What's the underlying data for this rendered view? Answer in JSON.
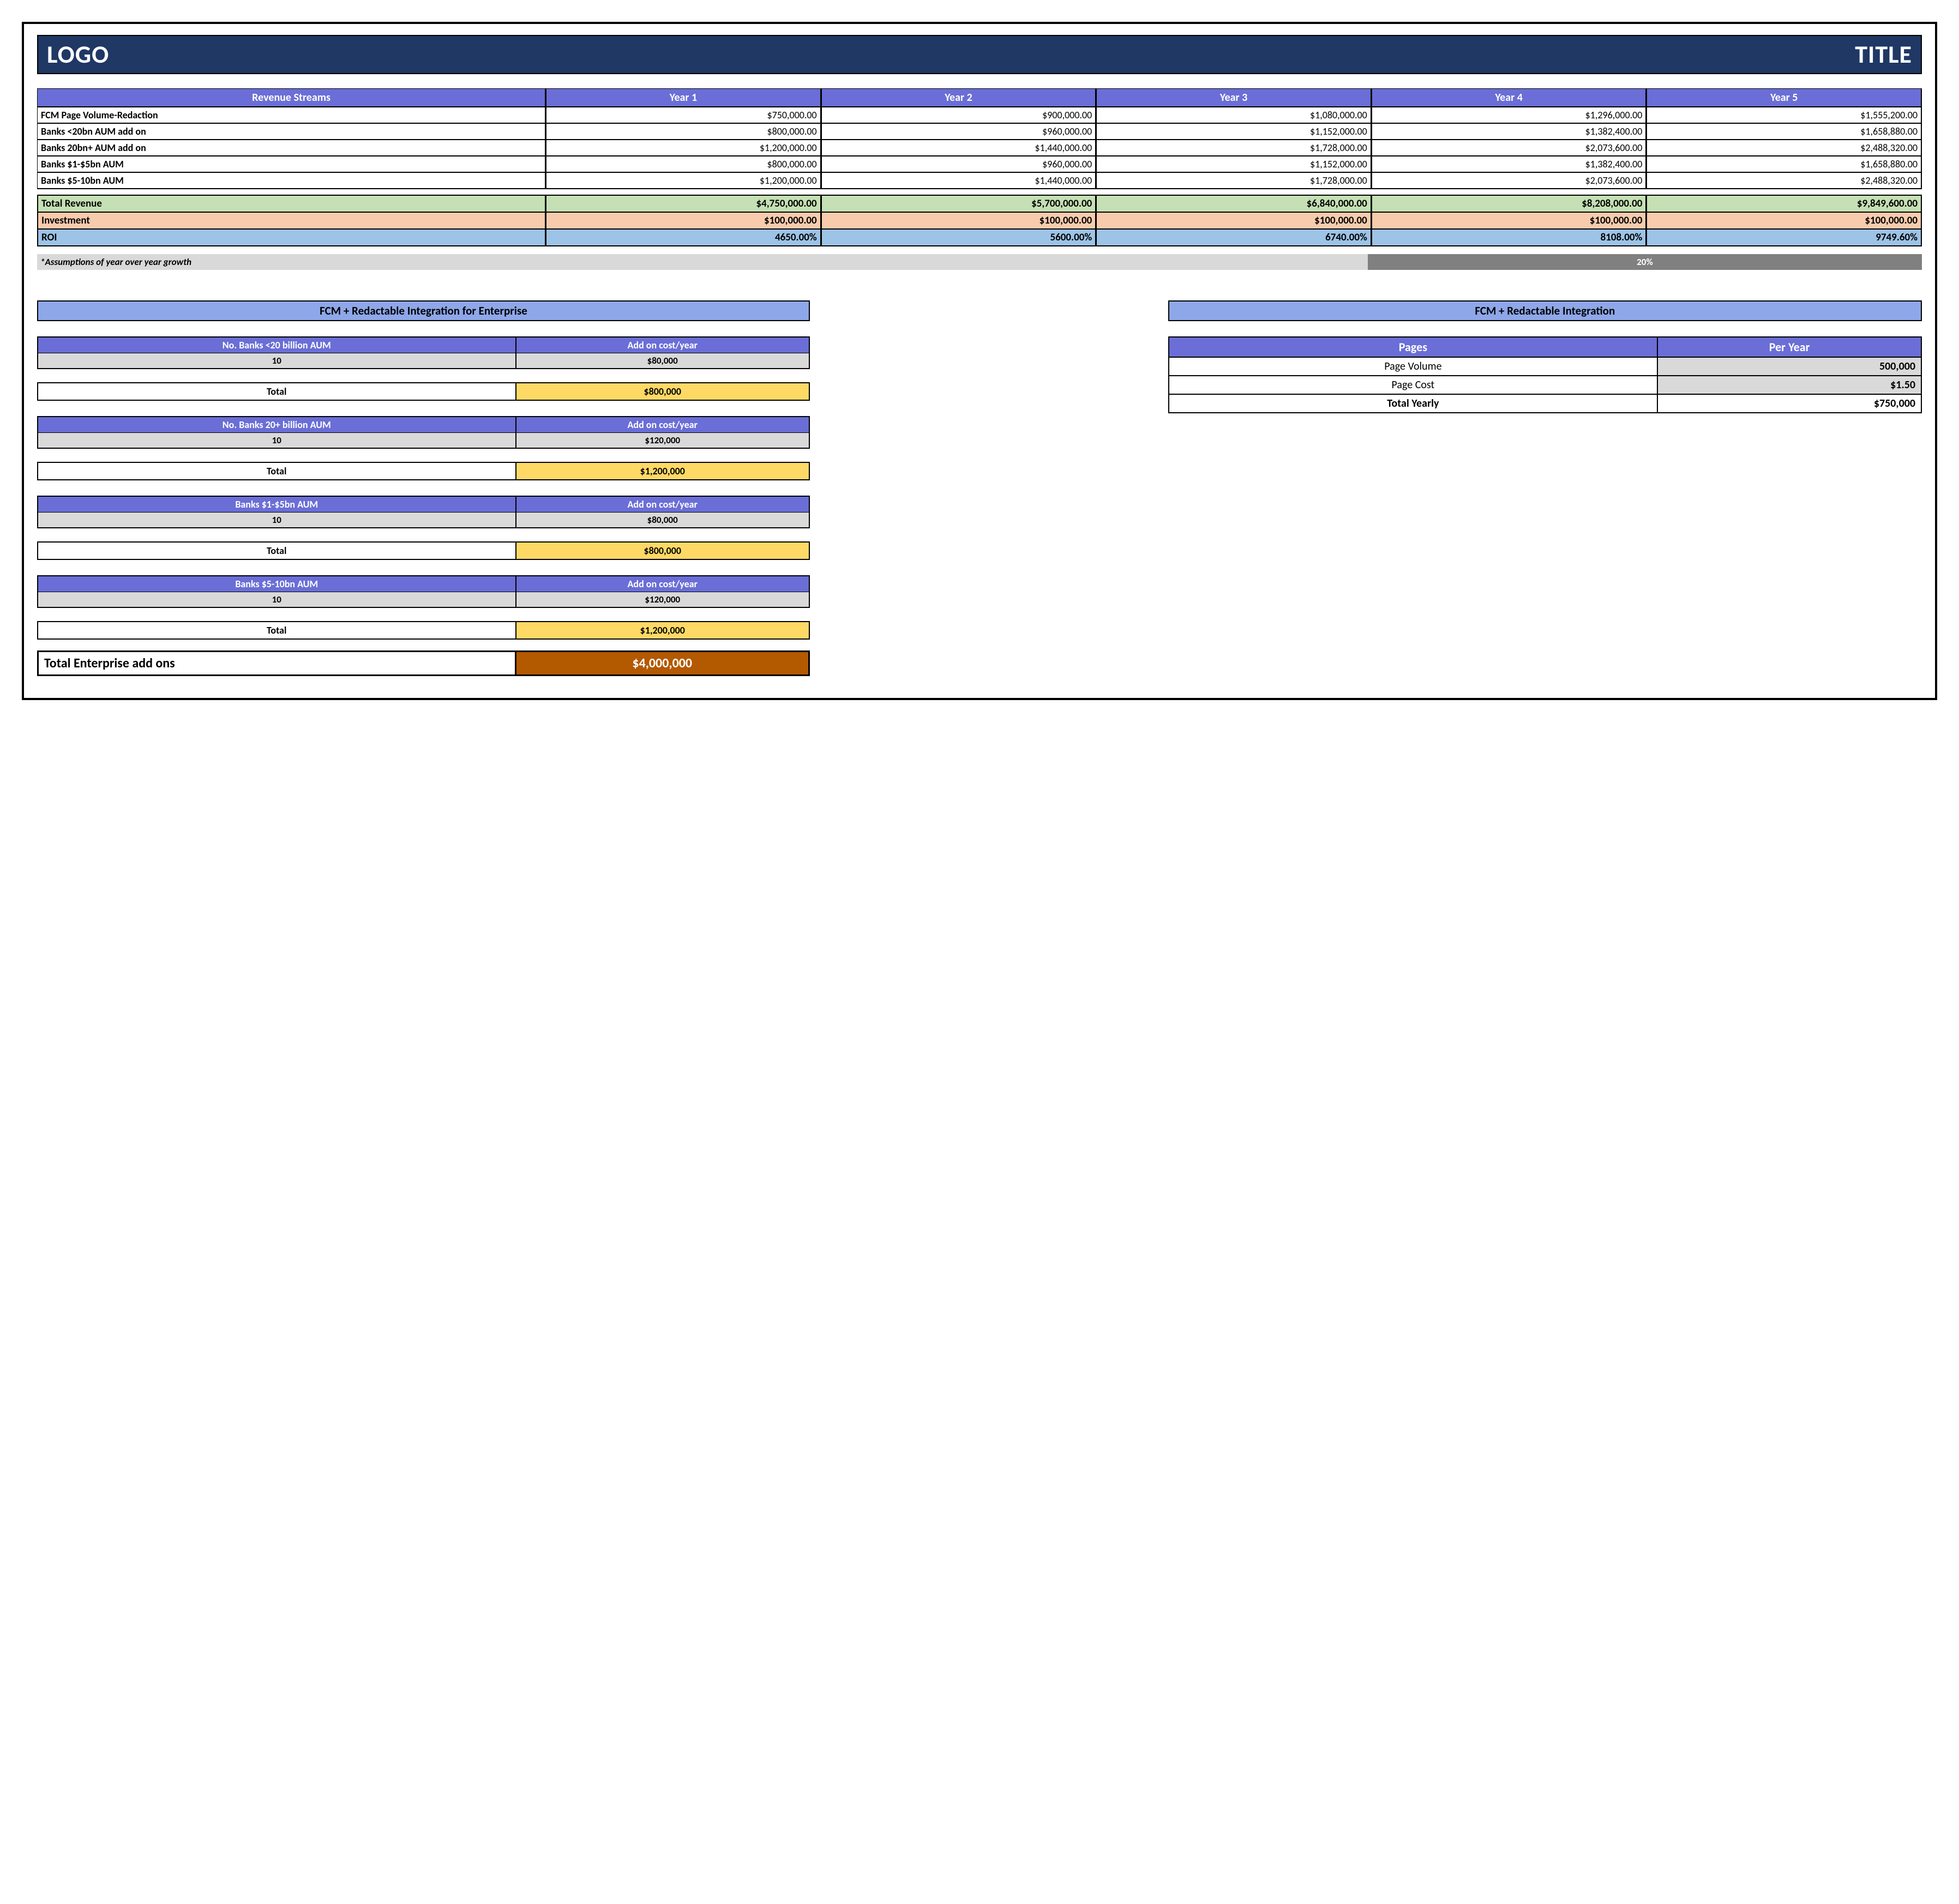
{
  "header": {
    "logo": "LOGO",
    "title": "TITLE"
  },
  "revenue": {
    "header_label": "Revenue Streams",
    "year_labels": [
      "Year 1",
      "Year 2",
      "Year 3",
      "Year 4",
      "Year 5"
    ],
    "rows": [
      {
        "label": "FCM Page Volume-Redaction",
        "vals": [
          "$750,000.00",
          "$900,000.00",
          "$1,080,000.00",
          "$1,296,000.00",
          "$1,555,200.00"
        ]
      },
      {
        "label": "Banks <20bn AUM add on",
        "vals": [
          "$800,000.00",
          "$960,000.00",
          "$1,152,000.00",
          "$1,382,400.00",
          "$1,658,880.00"
        ]
      },
      {
        "label": "Banks 20bn+ AUM add on",
        "vals": [
          "$1,200,000.00",
          "$1,440,000.00",
          "$1,728,000.00",
          "$2,073,600.00",
          "$2,488,320.00"
        ]
      },
      {
        "label": "Banks $1-$5bn AUM",
        "vals": [
          "$800,000.00",
          "$960,000.00",
          "$1,152,000.00",
          "$1,382,400.00",
          "$1,658,880.00"
        ]
      },
      {
        "label": "Banks $5-10bn AUM",
        "vals": [
          "$1,200,000.00",
          "$1,440,000.00",
          "$1,728,000.00",
          "$2,073,600.00",
          "$2,488,320.00"
        ]
      }
    ]
  },
  "summary": {
    "total_revenue_label": "Total Revenue",
    "total_revenue": [
      "$4,750,000.00",
      "$5,700,000.00",
      "$6,840,000.00",
      "$8,208,000.00",
      "$9,849,600.00"
    ],
    "investment_label": "Investment",
    "investment": [
      "$100,000.00",
      "$100,000.00",
      "$100,000.00",
      "$100,000.00",
      "$100,000.00"
    ],
    "roi_label": "ROI",
    "roi": [
      "4650.00%",
      "5600.00%",
      "6740.00%",
      "8108.00%",
      "9749.60%"
    ]
  },
  "assumption": {
    "text": "*Assumptions of year over year growth",
    "value": "20%"
  },
  "enterprise": {
    "title": "FCM + Redactable Integration for Enterprise",
    "groups": [
      {
        "h1": "No. Banks <20 billion AUM",
        "h2": "Add on cost/year",
        "v1": "10",
        "v2": "$80,000",
        "total_label": "Total",
        "total": "$800,000"
      },
      {
        "h1": "No. Banks 20+ billion AUM",
        "h2": "Add on cost/year",
        "v1": "10",
        "v2": "$120,000",
        "total_label": "Total",
        "total": "$1,200,000"
      },
      {
        "h1": "Banks $1-$5bn AUM",
        "h2": "Add on cost/year",
        "v1": "10",
        "v2": "$80,000",
        "total_label": "Total",
        "total": "$800,000"
      },
      {
        "h1": "Banks $5-10bn AUM",
        "h2": "Add on cost/year",
        "v1": "10",
        "v2": "$120,000",
        "total_label": "Total",
        "total": "$1,200,000"
      }
    ],
    "grand_label": "Total Enterprise add ons",
    "grand_total": "$4,000,000"
  },
  "integration": {
    "title": "FCM + Redactable Integration",
    "head1": "Pages",
    "head2": "Per Year",
    "rows": [
      {
        "label": "Page Volume",
        "value": "500,000"
      },
      {
        "label": "Page Cost",
        "value": "$1.50"
      }
    ],
    "total_label": "Total Yearly",
    "total_value": "$750,000"
  }
}
